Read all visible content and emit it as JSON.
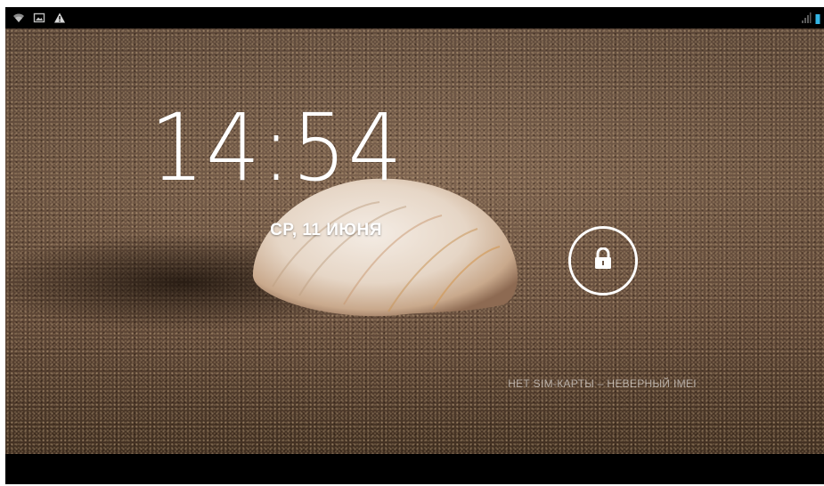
{
  "status_bar": {
    "left_icons": [
      "wifi-icon",
      "image-icon",
      "warning-icon"
    ],
    "right_icons": [
      "signal-icon",
      "battery-icon"
    ]
  },
  "lockscreen": {
    "time": "14:54",
    "date": "СР, 11 ИЮНЯ",
    "carrier": "НЕТ SIM-КАРТЫ – НЕВЕРНЫЙ IMEI",
    "unlock_icon": "lock-icon"
  },
  "colors": {
    "text": "#ffffff",
    "statusbar_bg": "#000000",
    "battery_accent": "#33b5e5"
  }
}
